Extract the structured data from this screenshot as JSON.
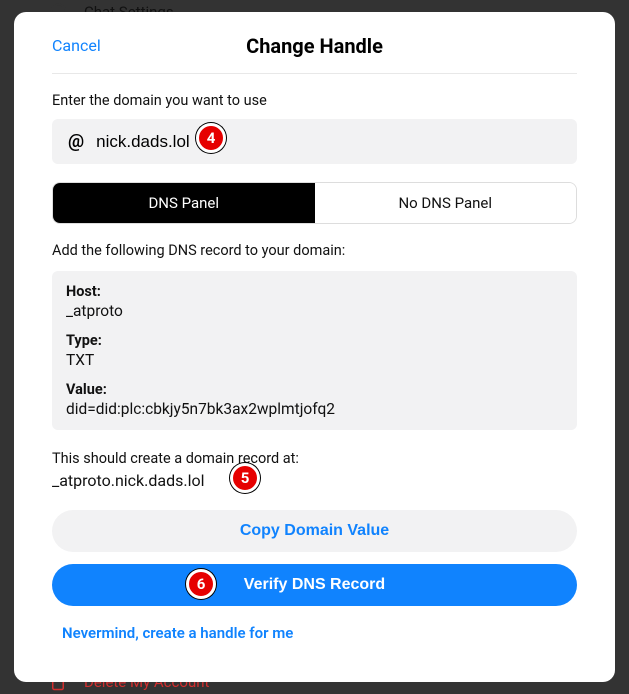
{
  "background": {
    "chat_settings_label": "Chat Settings",
    "delete_label": "Delete My Account"
  },
  "modal": {
    "cancel_label": "Cancel",
    "title": "Change Handle",
    "domain_section_label": "Enter the domain you want to use",
    "at_symbol": "@",
    "domain_value": "nick.dads.lol",
    "tabs": {
      "dns_panel": "DNS Panel",
      "no_dns_panel": "No DNS Panel"
    },
    "dns_instruction": "Add the following DNS record to your domain:",
    "record": {
      "host_label": "Host:",
      "host_value": "_atproto",
      "type_label": "Type:",
      "type_value": "TXT",
      "value_label": "Value:",
      "value_value": "did=did:plc:cbkjy5n7bk3ax2wplmtjofq2"
    },
    "result_label": "This should create a domain record at:",
    "result_domain": "_atproto.nick.dads.lol",
    "copy_button": "Copy Domain Value",
    "verify_button": "Verify DNS Record",
    "nevermind_link": "Nevermind, create a handle for me"
  },
  "annotations": {
    "a4": "4",
    "a5": "5",
    "a6": "6"
  }
}
